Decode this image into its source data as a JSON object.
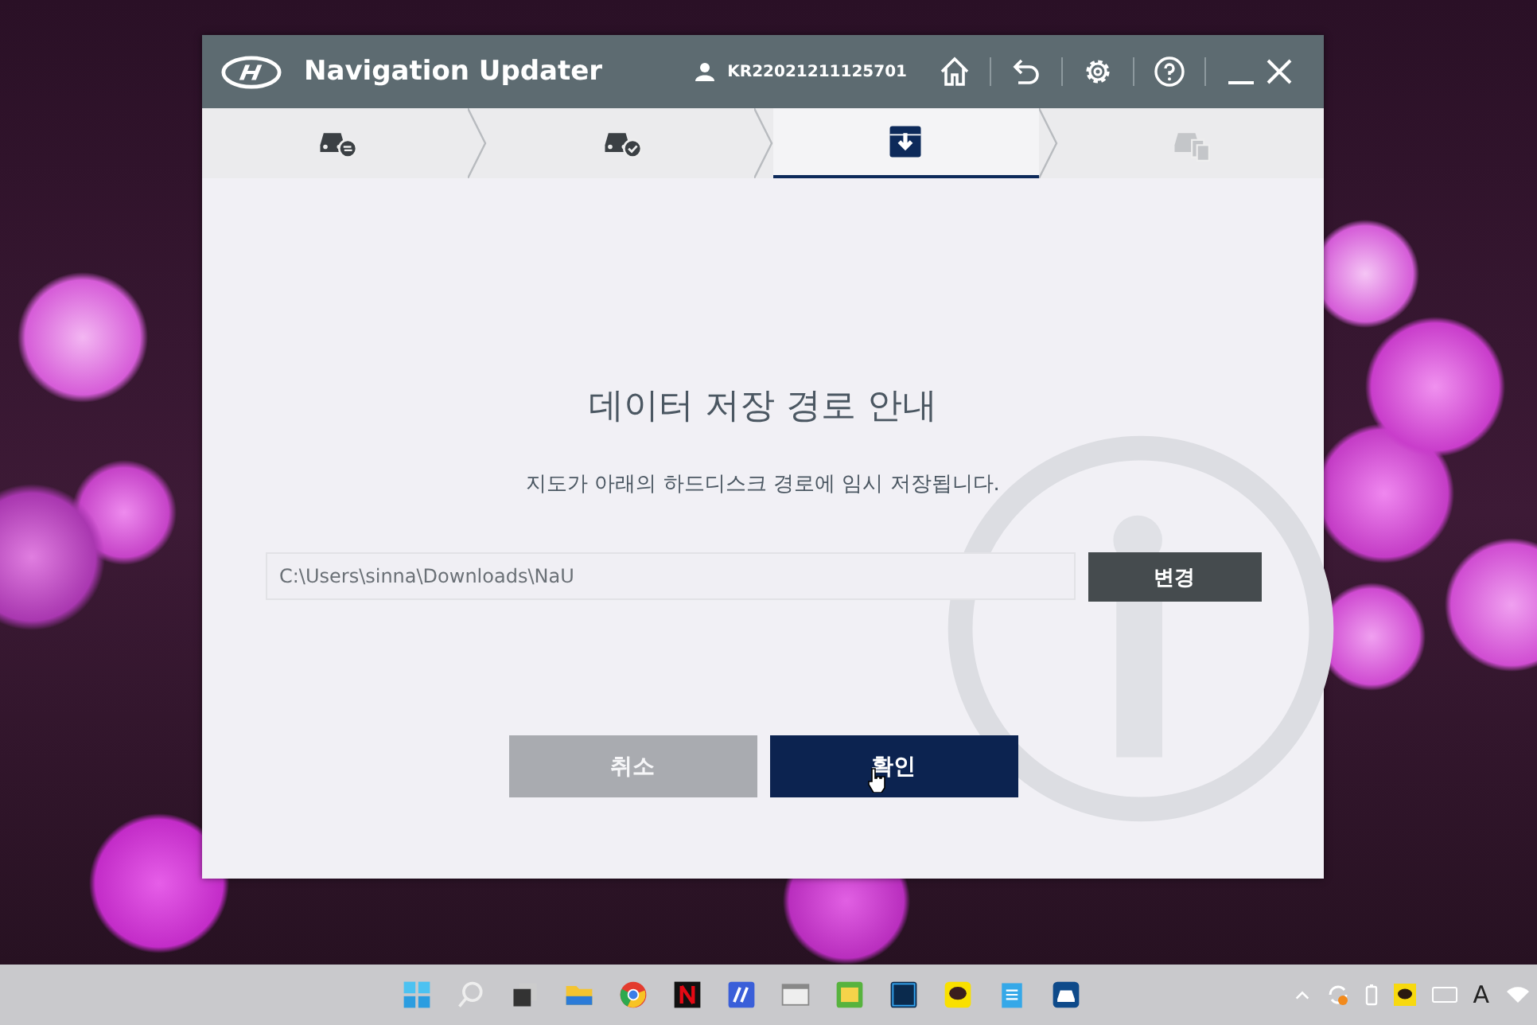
{
  "window": {
    "title": "Navigation Updater",
    "user_id": "KR22021211125701"
  },
  "steps": [
    {
      "selected": false,
      "disabled": false
    },
    {
      "selected": false,
      "disabled": false
    },
    {
      "selected": true,
      "disabled": false
    },
    {
      "selected": false,
      "disabled": true
    }
  ],
  "dialog": {
    "title": "데이터 저장 경로 안내",
    "message": "지도가 아래의 하드디스크 경로에 임시 저장됩니다.",
    "path_field": {
      "value": "C:\\Users\\sinna\\Downloads\\NaU"
    },
    "change_button": "변경",
    "buttons": [
      {
        "label": "취소",
        "disabled": true
      },
      {
        "label": "확인",
        "disabled": false
      }
    ]
  },
  "taskbar": {
    "input_indicator": "A"
  }
}
